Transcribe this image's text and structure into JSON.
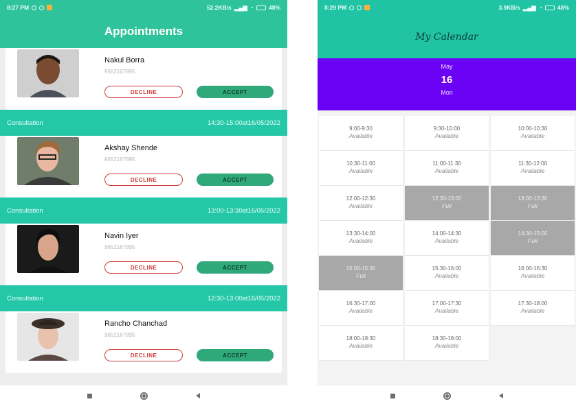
{
  "left": {
    "status": {
      "time": "8:27 PM",
      "speed": "52.2KB/s",
      "battery": "48%"
    },
    "title": "Appointments",
    "appointments": [
      {
        "name": "Nakul Borra",
        "phone": "9652167895",
        "decline": "DECLINE",
        "accept": "ACCEPT",
        "type": "Consultation",
        "time": "14:30-15:00at16/05/2022"
      },
      {
        "name": "Akshay Shende",
        "phone": "9652167895",
        "decline": "DECLINE",
        "accept": "ACCEPT",
        "type": "Consultation",
        "time": "13:00-13:30at16/05/2022"
      },
      {
        "name": "Navin Iyer",
        "phone": "9652167895",
        "decline": "DECLINE",
        "accept": "ACCEPT",
        "type": "Consultation",
        "time": "12:30-13:00at16/05/2022"
      },
      {
        "name": "Rancho Chanchad",
        "phone": "9652167895",
        "decline": "DECLINE",
        "accept": "ACCEPT"
      }
    ]
  },
  "right": {
    "status": {
      "time": "8:29 PM",
      "speed": "3.9KB/s",
      "battery": "48%"
    },
    "title": "My Calendar",
    "date": {
      "month": "May",
      "day": "16",
      "weekday": "Mon"
    },
    "slots": [
      {
        "time": "9:00-9:30",
        "status": "Available"
      },
      {
        "time": "9:30-10:00",
        "status": "Available"
      },
      {
        "time": "10:00-10:30",
        "status": "Available"
      },
      {
        "time": "10:30-11:00",
        "status": "Available"
      },
      {
        "time": "11:00-11:30",
        "status": "Available"
      },
      {
        "time": "11:30-12:00",
        "status": "Available"
      },
      {
        "time": "12:00-12:30",
        "status": "Available"
      },
      {
        "time": "12:30-13:00",
        "status": "Full"
      },
      {
        "time": "13:00-13:30",
        "status": "Full"
      },
      {
        "time": "13:30-14:00",
        "status": "Available"
      },
      {
        "time": "14:00-14:30",
        "status": "Available"
      },
      {
        "time": "14:30-15:00",
        "status": "Full"
      },
      {
        "time": "15:00-15:30",
        "status": "Full"
      },
      {
        "time": "15:30-16:00",
        "status": "Available"
      },
      {
        "time": "16:00-16:30",
        "status": "Available"
      },
      {
        "time": "16:30-17:00",
        "status": "Available"
      },
      {
        "time": "17:00-17:30",
        "status": "Available"
      },
      {
        "time": "17:30-18:00",
        "status": "Available"
      },
      {
        "time": "18:00-18:30",
        "status": "Available"
      },
      {
        "time": "18:30-19:00",
        "status": "Available"
      }
    ]
  }
}
